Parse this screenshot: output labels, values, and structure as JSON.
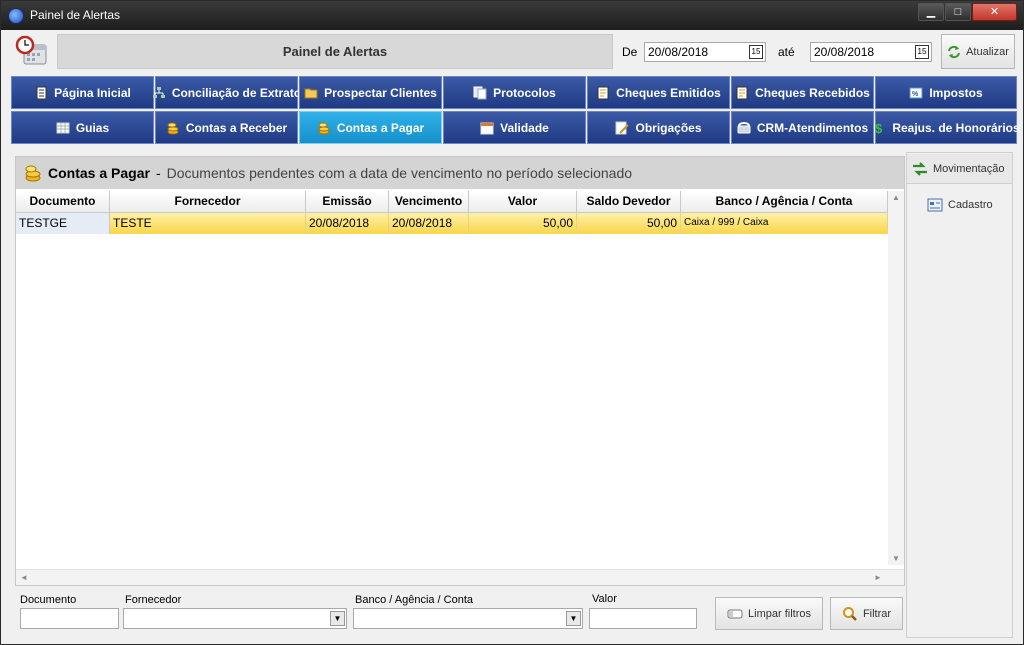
{
  "window": {
    "title": "Painel de Alertas",
    "min": "▁",
    "max": "□",
    "close": "✕"
  },
  "header": {
    "title": "Painel de Alertas",
    "from_label": "De",
    "from_value": "20/08/2018",
    "to_label": "até",
    "to_value": "20/08/2018",
    "cal_glyph": "15",
    "refresh_label": "Atualizar"
  },
  "nav": [
    {
      "label": "Página Inicial",
      "icon": "document-icon"
    },
    {
      "label": "Conciliação de Extrato",
      "icon": "network-icon"
    },
    {
      "label": "Prospectar Clientes",
      "icon": "folder-icon"
    },
    {
      "label": "Protocolos",
      "icon": "copy-icon"
    },
    {
      "label": "Cheques Emitidos",
      "icon": "cheque-icon"
    },
    {
      "label": "Cheques Recebidos",
      "icon": "cheque-icon"
    },
    {
      "label": "Impostos",
      "icon": "tax-icon"
    },
    {
      "label": "Guias",
      "icon": "table-icon"
    },
    {
      "label": "Contas a Receber",
      "icon": "coins-icon"
    },
    {
      "label": "Contas a Pagar",
      "icon": "coins-icon",
      "active": true
    },
    {
      "label": "Validade",
      "icon": "calendar-icon"
    },
    {
      "label": "Obrigações",
      "icon": "edit-icon"
    },
    {
      "label": "CRM-Atendimentos",
      "icon": "phone-icon"
    },
    {
      "label": "Reajus. de Honorários",
      "icon": "dollar-icon"
    }
  ],
  "section": {
    "title": "Contas a Pagar",
    "sep": "-",
    "subtitle": "Documentos pendentes com a data de vencimento no período selecionado"
  },
  "table": {
    "columns": [
      "Documento",
      "Fornecedor",
      "Emissão",
      "Vencimento",
      "Valor",
      "Saldo Devedor",
      "Banco / Agência / Conta"
    ],
    "rows": [
      [
        "TESTGE",
        "TESTE",
        "20/08/2018",
        "20/08/2018",
        "50,00",
        "50,00",
        "Caixa / 999 / Caixa"
      ]
    ]
  },
  "filters": {
    "documento_label": "Documento",
    "fornecedor_label": "Fornecedor",
    "banco_label": "Banco / Agência / Conta",
    "valor_label": "Valor",
    "clear_label": "Limpar filtros",
    "filter_label": "Filtrar",
    "dd_glyph": "▼"
  },
  "side": [
    {
      "label": "Movimentação"
    },
    {
      "label": "Cadastro"
    }
  ],
  "scroll": {
    "up": "▲",
    "down": "▼",
    "left": "◄",
    "right": "►"
  }
}
